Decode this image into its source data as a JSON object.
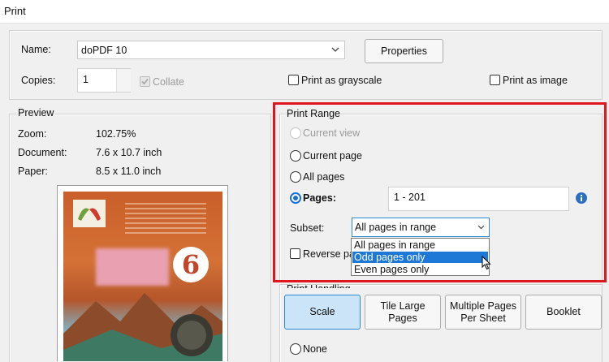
{
  "window": {
    "title": "Print"
  },
  "printer": {
    "name_label": "Name:",
    "name_value": "doPDF 10",
    "properties_label": "Properties",
    "copies_label": "Copies:",
    "copies_value": "1",
    "collate_label": "Collate",
    "grayscale_label": "Print as grayscale",
    "image_label": "Print as image"
  },
  "preview": {
    "heading": "Preview",
    "zoom_label": "Zoom:",
    "zoom_value": "102.75%",
    "document_label": "Document:",
    "document_value": "7.6 x 10.7 inch",
    "paper_label": "Paper:",
    "paper_value": "8.5 x 11.0 inch",
    "page_number": "6"
  },
  "print_range": {
    "heading": "Print Range",
    "current_view": "Current view",
    "current_page": "Current page",
    "all_pages": "All pages",
    "pages_label": "Pages:",
    "pages_value": "1 - 201",
    "subset_label": "Subset:",
    "subset_value": "All pages in range",
    "subset_options": [
      "All pages in range",
      "Odd pages only",
      "Even pages only"
    ],
    "subset_highlighted": "Odd pages only",
    "reverse_label": "Reverse pa",
    "highlight_color": "#e0161e"
  },
  "page_handling": {
    "heading": "Print Handling",
    "scale_label": "Scale",
    "tile_label": "Tile Large Pages",
    "multiple_label": "Multiple Pages Per Sheet",
    "booklet_label": "Booklet",
    "none_label": "None"
  }
}
